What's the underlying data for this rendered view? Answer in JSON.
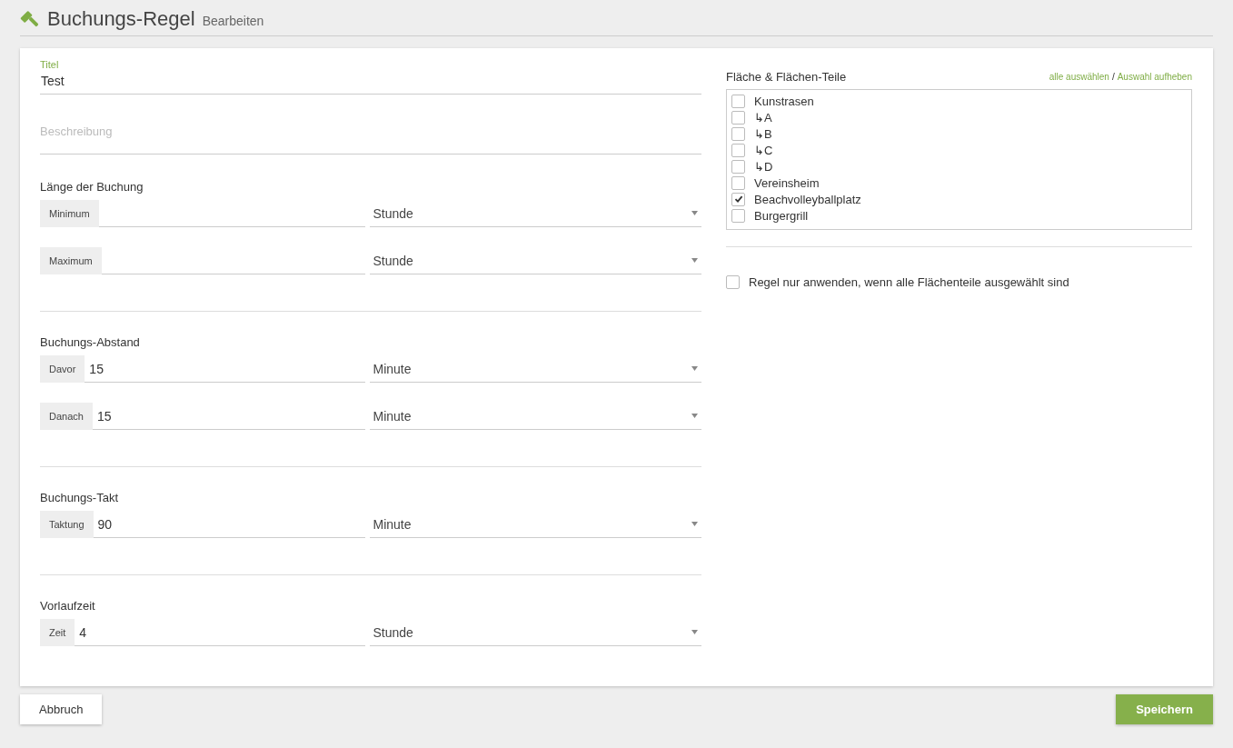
{
  "header": {
    "title": "Buchungs-Regel",
    "subtitle": "Bearbeiten"
  },
  "form": {
    "title_field": {
      "label": "Titel",
      "value": "Test"
    },
    "description_field": {
      "placeholder": "Beschreibung"
    },
    "groups": [
      {
        "heading": "Länge der Buchung",
        "rows": [
          {
            "addon": "Minimum",
            "unit": "Stunde"
          },
          {
            "addon": "Maximum",
            "unit": "Stunde"
          }
        ]
      },
      {
        "heading": "Buchungs-Abstand",
        "rows": [
          {
            "addon": "Davor",
            "value": "15",
            "unit": "Minute"
          },
          {
            "addon": "Danach",
            "value": "15",
            "unit": "Minute"
          }
        ]
      },
      {
        "heading": "Buchungs-Takt",
        "rows": [
          {
            "addon": "Taktung",
            "value": "90",
            "unit": "Minute"
          }
        ]
      },
      {
        "heading": "Vorlaufzeit",
        "rows": [
          {
            "addon": "Zeit",
            "value": "4",
            "unit": "Stunde"
          }
        ]
      }
    ]
  },
  "areas": {
    "heading": "Fläche & Flächen-Teile",
    "select_all": "alle auswählen",
    "separator": "/",
    "deselect": "Auswahl aufheben",
    "items": [
      {
        "label": "Kunstrasen",
        "checked": false,
        "children": [
          {
            "label": "↳A",
            "checked": false
          },
          {
            "label": "↳B",
            "checked": false
          },
          {
            "label": "↳C",
            "checked": false
          },
          {
            "label": "↳D",
            "checked": false
          }
        ]
      },
      {
        "label": "Vereinsheim",
        "checked": false
      },
      {
        "label": "Beachvolleyballplatz",
        "checked": true
      },
      {
        "label": "Burgergrill",
        "checked": false
      }
    ]
  },
  "only_all_parts": {
    "label": "Regel nur anwenden, wenn alle Flächenteile ausgewählt sind",
    "checked": false
  },
  "buttons": {
    "cancel": "Abbruch",
    "save": "Speichern"
  }
}
